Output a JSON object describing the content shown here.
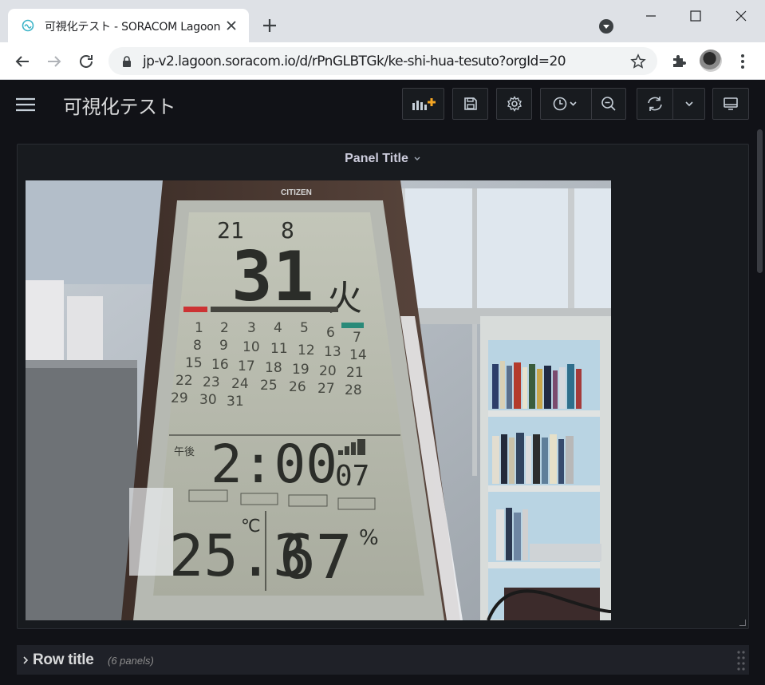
{
  "browser": {
    "tab_title": "可視化テスト - SORACOM Lagoon",
    "url": "jp-v2.lagoon.soracom.io/d/rPnGLBTGk/ke-shi-hua-tesuto?orgId=20"
  },
  "dashboard": {
    "title": "可視化テスト",
    "toolbar_icons": [
      "add-panel-icon",
      "save-icon",
      "settings-icon",
      "clock-icon",
      "zoom-out-icon",
      "refresh-icon",
      "chevron-down-icon",
      "tv-icon"
    ]
  },
  "panel": {
    "title": "Panel Title",
    "image": {
      "brand": "CITIZEN",
      "time_top": "21",
      "month": "8",
      "day": "31",
      "weekday": "火",
      "calendar_rows": [
        [
          "1",
          "2",
          "3",
          "4",
          "5",
          "6",
          "7"
        ],
        [
          "8",
          "9",
          "10",
          "11",
          "12",
          "13",
          "14"
        ],
        [
          "15",
          "16",
          "17",
          "18",
          "19",
          "20",
          "21"
        ],
        [
          "22",
          "23",
          "24",
          "25",
          "26",
          "27",
          "28"
        ],
        [
          "29",
          "30",
          "31"
        ]
      ],
      "ampm": "午後",
      "clock_time": "2:00",
      "seconds": "07",
      "temperature": "25.3",
      "temperature_unit": "℃",
      "humidity": "67",
      "humidity_unit": "%"
    }
  },
  "row": {
    "title": "Row title",
    "count": "(6 panels)"
  },
  "colors": {
    "grafana_bg": "#111217",
    "panel_bg": "#181b1f",
    "accent_orange": "#f5a623"
  }
}
